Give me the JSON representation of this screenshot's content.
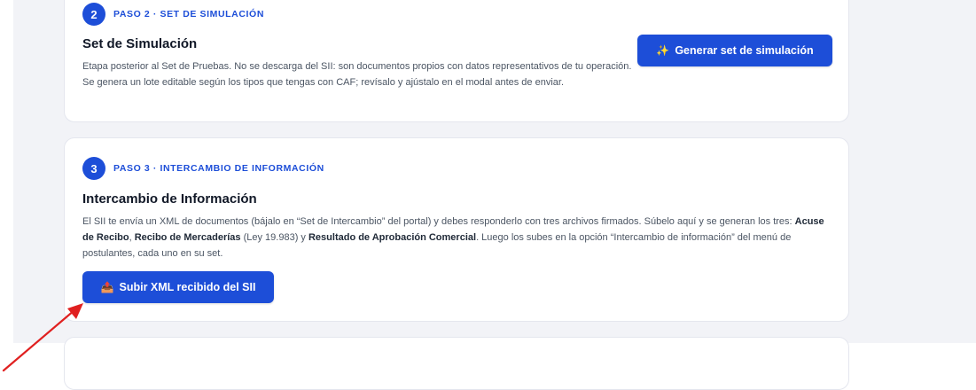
{
  "step2": {
    "number": "2",
    "label": "PASO 2 · SET DE SIMULACIÓN",
    "title": "Set de Simulación",
    "description": "Etapa posterior al Set de Pruebas. No se descarga del SII: son documentos propios con datos representativos de tu operación. Se genera un lote editable según los tipos que tengas con CAF; revísalo y ajústalo en el modal antes de enviar.",
    "button_icon": "✨",
    "button_label": "Generar set de simulación"
  },
  "step3": {
    "number": "3",
    "label": "PASO 3 · INTERCAMBIO DE INFORMACIÓN",
    "title": "Intercambio de Información",
    "desc": {
      "part1": "El SII te envía un XML de documentos (bájalo en “Set de Intercambio” del portal) y debes responderlo con tres archivos firmados. Súbelo aquí y se generan los tres: ",
      "b1": "Acuse de Recibo",
      "sep1": ", ",
      "b2": "Recibo de Mercaderías",
      "part2": " (Ley 19.983) y ",
      "b3": "Resultado de Aprobación Comercial",
      "part3": ". Luego los subes en la opción “Intercambio de información” del menú de postulantes, cada uno en su set."
    },
    "button_icon": "📤",
    "button_label": "Subir XML recibido del SII"
  },
  "colors": {
    "accent": "#1d4ed8",
    "annotation_arrow": "#e02020"
  },
  "icons": {
    "generate": "sparkles-icon",
    "upload": "upload-tray-icon",
    "annotation": "red-arrow-annotation"
  }
}
